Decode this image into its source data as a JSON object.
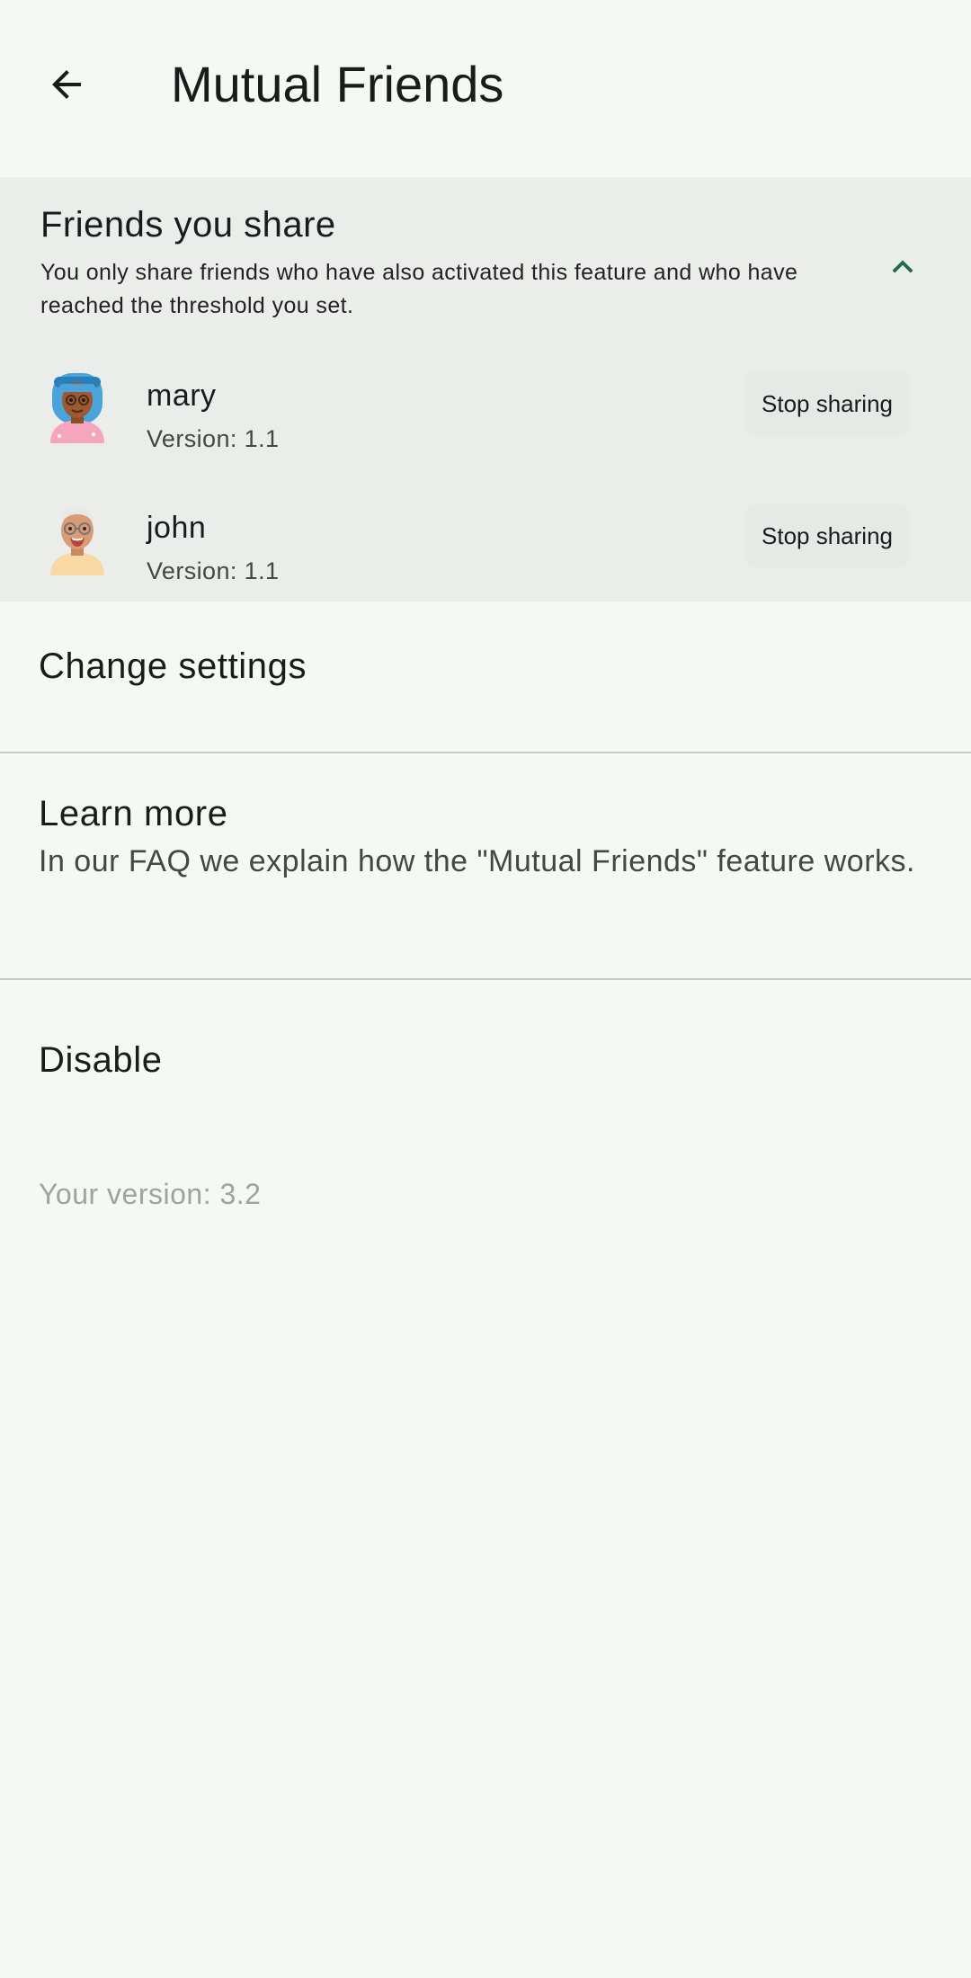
{
  "header": {
    "title": "Mutual Friends",
    "back_icon": "arrow-back-icon"
  },
  "share_panel": {
    "title": "Friends you share",
    "description": "You only share friends who have also activated this feature and who have reached the threshold you set.",
    "collapse_icon": "chevron-up-icon",
    "accent_color": "#1e6b4e",
    "friends": [
      {
        "name": "mary",
        "version": "Version: 1.1",
        "action": "Stop sharing",
        "avatar": "woman-blue-hair-avatar"
      },
      {
        "name": "john",
        "version": "Version: 1.1",
        "action": "Stop sharing",
        "avatar": "old-man-glasses-avatar"
      }
    ]
  },
  "settings": {
    "change_settings": "Change settings",
    "learn_more_title": "Learn more",
    "learn_more_text": "In our FAQ we explain how the \"Mutual Friends\" feature works.",
    "disable": "Disable",
    "your_version": "Your version: 3.2"
  }
}
